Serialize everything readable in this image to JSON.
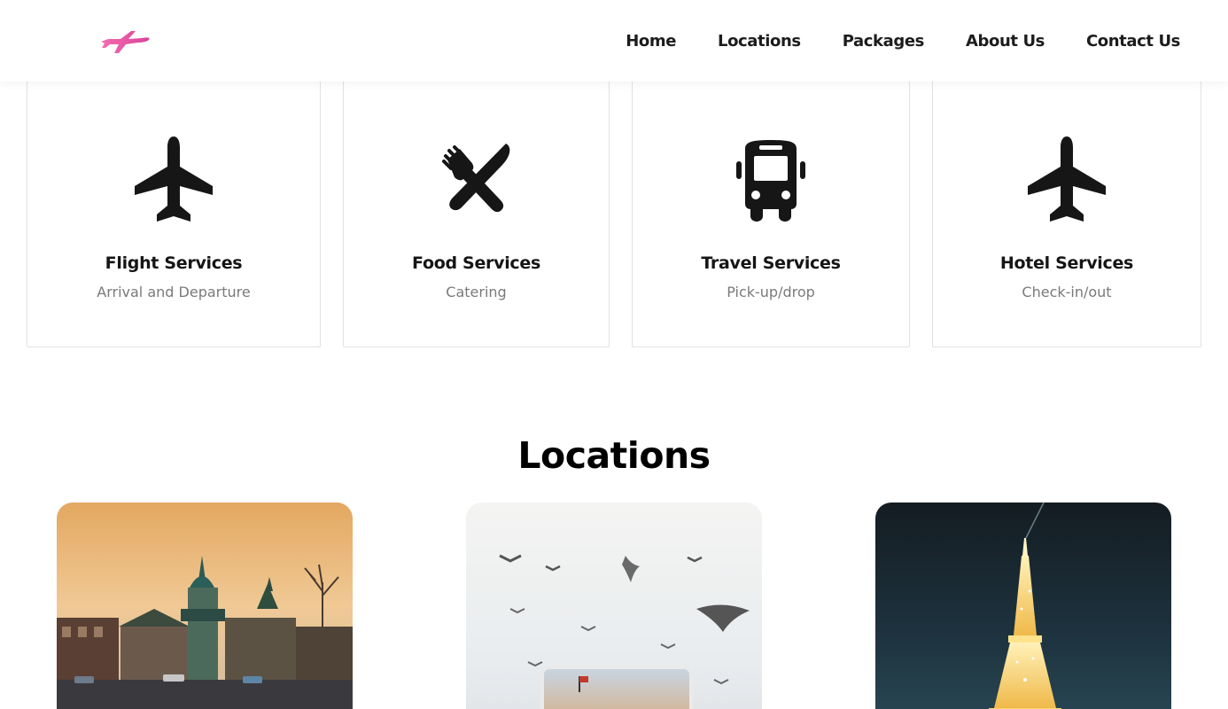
{
  "nav": {
    "logo_icon": "airplane-logo-icon",
    "brand_color": "#ec5aa6",
    "links": [
      "Home",
      "Locations",
      "Packages",
      "About Us",
      "Contact Us"
    ]
  },
  "services": [
    {
      "icon": "airplane-icon",
      "title": "Flight Services",
      "subtitle": "Arrival and Departure"
    },
    {
      "icon": "fork-knife-icon",
      "title": "Food Services",
      "subtitle": "Catering"
    },
    {
      "icon": "bus-icon",
      "title": "Travel Services",
      "subtitle": "Pick-up/drop"
    },
    {
      "icon": "airplane-icon",
      "title": "Hotel Services",
      "subtitle": "Check-in/out"
    }
  ],
  "locations": {
    "title": "Locations",
    "cards": [
      {
        "image": "lakeside-mosque-sunset-photo"
      },
      {
        "image": "seagulls-postcard-photo"
      },
      {
        "image": "eiffel-tower-night-photo"
      }
    ]
  }
}
